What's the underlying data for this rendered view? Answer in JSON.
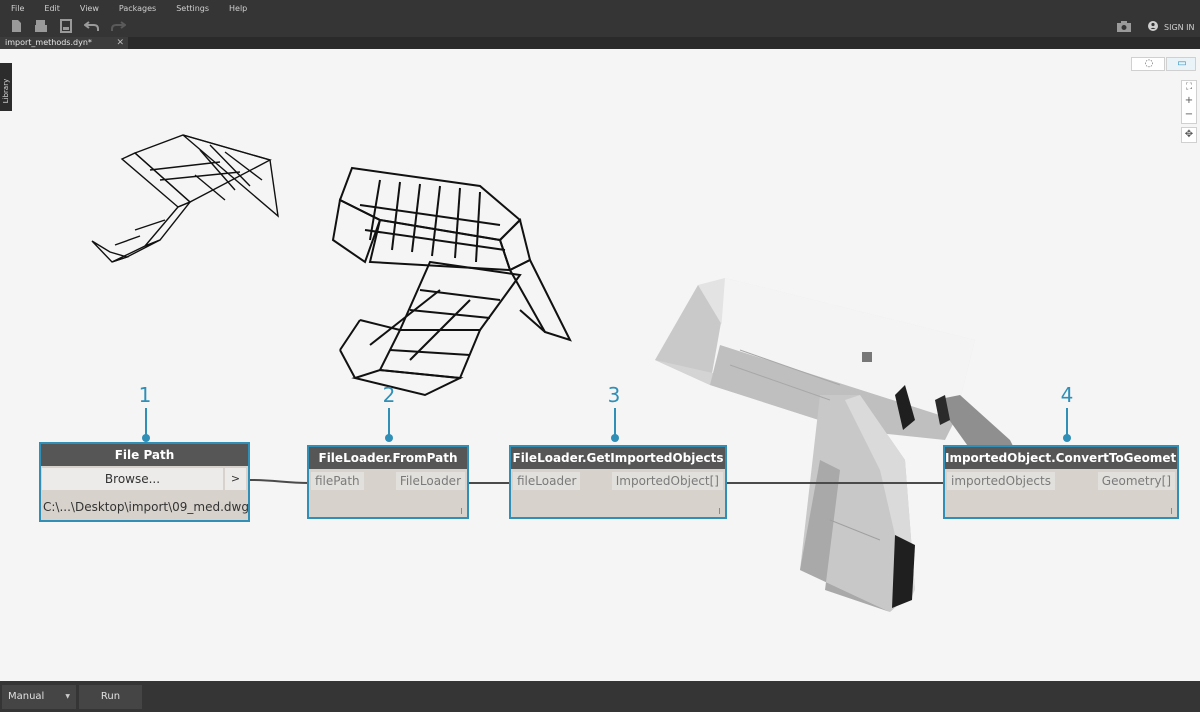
{
  "menu": [
    "File",
    "Edit",
    "View",
    "Packages",
    "Settings",
    "Help"
  ],
  "toolbar": {
    "icons": [
      "new-file-icon",
      "open-file-icon",
      "save-icon",
      "undo-icon",
      "redo-icon"
    ],
    "camera_icon": "camera-icon",
    "sign_in_label": "SIGN IN"
  },
  "tab": {
    "label": "import_methods.dyn*",
    "close": "✕"
  },
  "library": {
    "label": "Library"
  },
  "nodes": {
    "file_path": {
      "title": "File Path",
      "browse": "Browse...",
      "arrow": ">",
      "path": "C:\\...\\Desktop\\import\\09_med.dwg"
    },
    "from_path": {
      "title": "FileLoader.FromPath",
      "input": "filePath",
      "output": "FileLoader"
    },
    "get_imported": {
      "title": "FileLoader.GetImportedObjects",
      "input": "fileLoader",
      "output": "ImportedObject[]"
    },
    "convert": {
      "title": "ImportedObject.ConvertToGeometries",
      "input": "importedObjects",
      "output": "Geometry[]"
    }
  },
  "callouts": [
    "1",
    "2",
    "3",
    "4"
  ],
  "viewport": {
    "fit": "⛶",
    "zoom_in": "+",
    "zoom_out": "−",
    "pan": "✥"
  },
  "bottom": {
    "mode": "Manual",
    "caret": "▼",
    "run": "Run"
  },
  "colors": {
    "accent": "#2f8fb6",
    "chrome": "#353535",
    "canvas": "#f5f5f5"
  }
}
